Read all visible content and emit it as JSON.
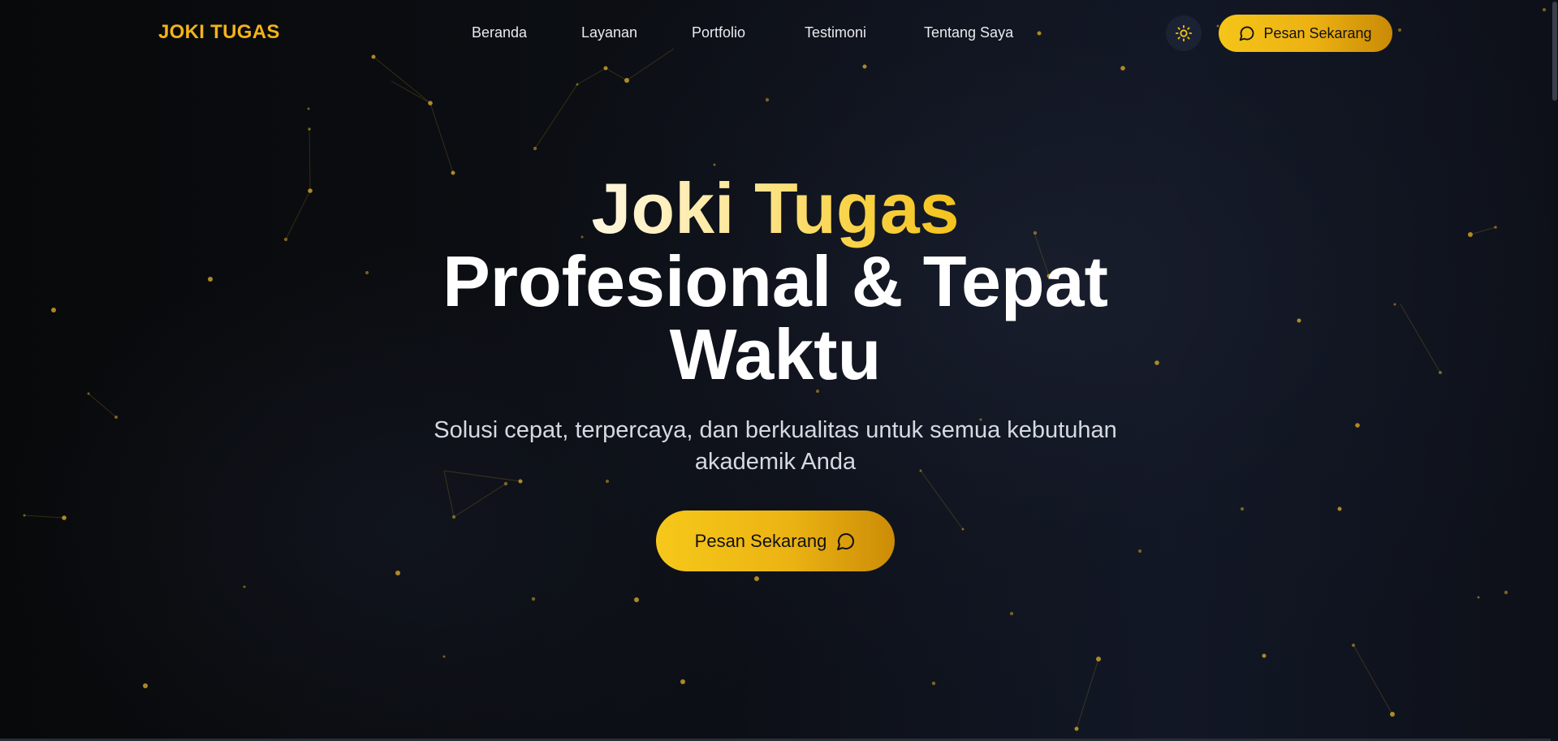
{
  "navbar": {
    "logo": "JOKI TUGAS",
    "links": [
      "Beranda",
      "Layanan",
      "Portfolio",
      "Testimoni",
      "Tentang Saya"
    ],
    "theme_toggle_icon": "sun-icon",
    "cta_label": "Pesan Sekarang",
    "cta_icon": "chat-bubble-icon"
  },
  "hero": {
    "title_highlight": "Joki Tugas",
    "title_line2": "Profesional & Tepat",
    "title_line3": "Waktu",
    "subtitle_line1": "Solusi cepat, terpercaya, dan berkualitas untuk semua kebutuhan",
    "subtitle_line2": "akademik Anda",
    "cta_label": "Pesan Sekarang",
    "cta_icon": "chat-bubble-icon"
  },
  "colors": {
    "accent": "#f5c518",
    "accent_dark": "#c98a06",
    "logo": "#f2b319",
    "background": "#0a0c10",
    "particle": "#c9a227"
  }
}
